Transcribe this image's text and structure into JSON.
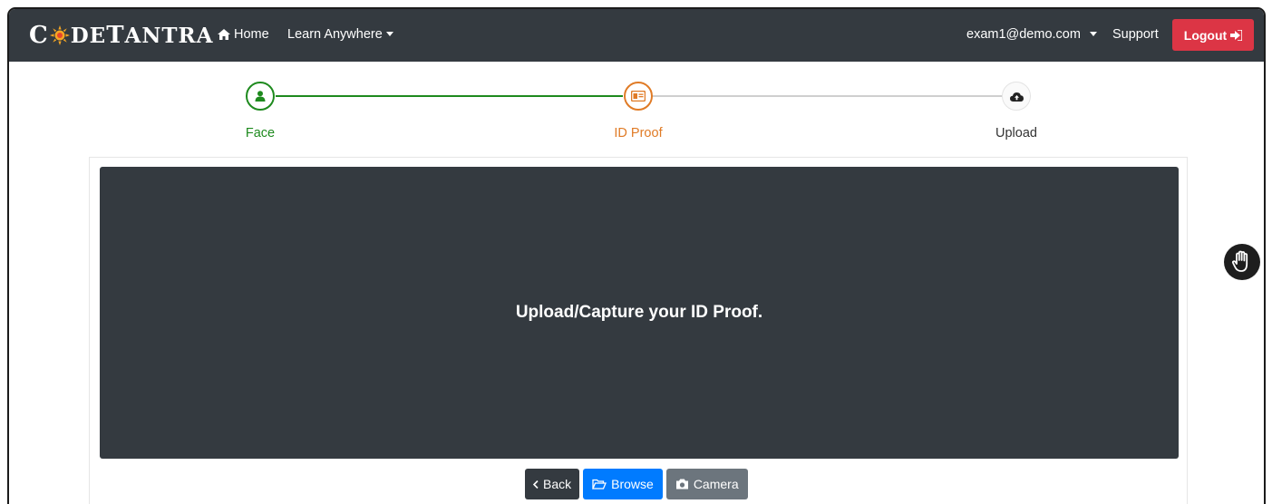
{
  "navbar": {
    "brand": {
      "part1": "C",
      "part2": "DE",
      "part3": "T",
      "part4": "ANTRA"
    },
    "home_label": "Home",
    "learn_label": "Learn Anywhere",
    "email_label": "exam1@demo.com",
    "support_label": "Support",
    "logout_label": "Logout"
  },
  "stepper": {
    "steps": [
      {
        "label": "Face",
        "icon": "user-icon",
        "state": "done"
      },
      {
        "label": "ID Proof",
        "icon": "id-card-icon",
        "state": "active"
      },
      {
        "label": "Upload",
        "icon": "cloud-upload-icon",
        "state": "pending"
      }
    ]
  },
  "main": {
    "message": "Upload/Capture your ID Proof.",
    "buttons": {
      "back": "Back",
      "browse": "Browse",
      "camera": "Camera"
    }
  },
  "colors": {
    "navbar": "#343a40",
    "logout": "#dc3545",
    "done": "#1e8a1e",
    "active": "#e07b26",
    "browse": "#007bff",
    "camera": "#6c757d"
  }
}
